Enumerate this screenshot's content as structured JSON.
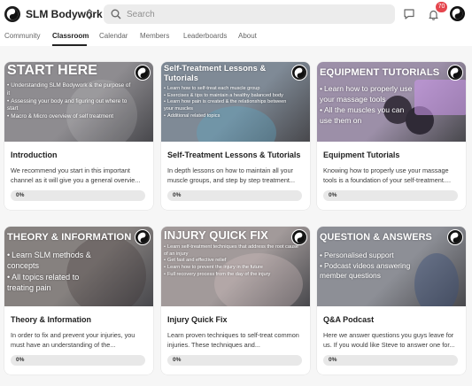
{
  "header": {
    "brand": "SLM Bodywork",
    "search_placeholder": "Search",
    "notification_count": "70"
  },
  "tabs": [
    {
      "label": "Community",
      "active": false
    },
    {
      "label": "Classroom",
      "active": true
    },
    {
      "label": "Calendar",
      "active": false
    },
    {
      "label": "Members",
      "active": false
    },
    {
      "label": "Leaderboards",
      "active": false
    },
    {
      "label": "About",
      "active": false
    }
  ],
  "courses": [
    {
      "cover_title": "START HERE",
      "cover_bullets": [
        "Understanding SLM Bodywork & the purpose of it",
        "Assessing your body and figuring out where to start",
        "Macro & Micro overview of self treatment"
      ],
      "title": "Introduction",
      "description": "We recommend you start in this important channel as it will give you a general overvie...",
      "progress_label": "0%",
      "progress": 0,
      "cover_color": "#8e8c90"
    },
    {
      "cover_title": "Self-Treatment Lessons & Tutorials",
      "cover_bullets": [
        "Learn how to self-treat each muscle group",
        "Exercises & tips to maintain a healthy balanced body",
        "Learn how pain is created & the relationships between your muscles",
        "Additional related topics"
      ],
      "title": "Self-Treatment Lessons & Tutorials",
      "description": "In depth lessons on how to maintain all your muscle groups, and step by step treatment...",
      "progress_label": "0%",
      "progress": 0,
      "cover_color": "#7f8a96"
    },
    {
      "cover_title": "EQUIPMENT TUTORIALS",
      "cover_bullets": [
        "Learn how to properly use your massage tools",
        "All the muscles you can use them on"
      ],
      "title": "Equipment Tutorials",
      "description": "Knowing how to properly use your massage tools is a foundation of your self-treatment....",
      "progress_label": "0%",
      "progress": 0,
      "cover_color": "#9c8fa8"
    },
    {
      "cover_title": "THEORY & INFORMATION",
      "cover_bullets": [
        "Learn SLM methods & concepts",
        "All topics related to treating pain"
      ],
      "title": "Theory & Information",
      "description": "In order to fix and prevent your injuries, you must have an understanding of the...",
      "progress_label": "0%",
      "progress": 0,
      "cover_color": "#86817f"
    },
    {
      "cover_title": "INJURY QUICK FIX",
      "cover_bullets": [
        "Learn self-treatment techniques that address the root cause of an injury",
        "Get fast and effective relief",
        "Learn how to prevent the injury in the future",
        "Full recovery process from the day of the injury"
      ],
      "title": "Injury Quick Fix",
      "description": "Learn proven techniques to self-treat common injuries. These techniques and...",
      "progress_label": "0%",
      "progress": 0,
      "cover_color": "#a29a9a"
    },
    {
      "cover_title": "QUESTION & ANSWERS",
      "cover_bullets": [
        "Personalised support",
        "Podcast videos answering member questions"
      ],
      "title": "Q&A Podcast",
      "description": "Here we answer questions you guys leave for us. If you would like Steve to answer one for...",
      "progress_label": "0%",
      "progress": 0,
      "cover_color": "#8d8f96"
    }
  ]
}
